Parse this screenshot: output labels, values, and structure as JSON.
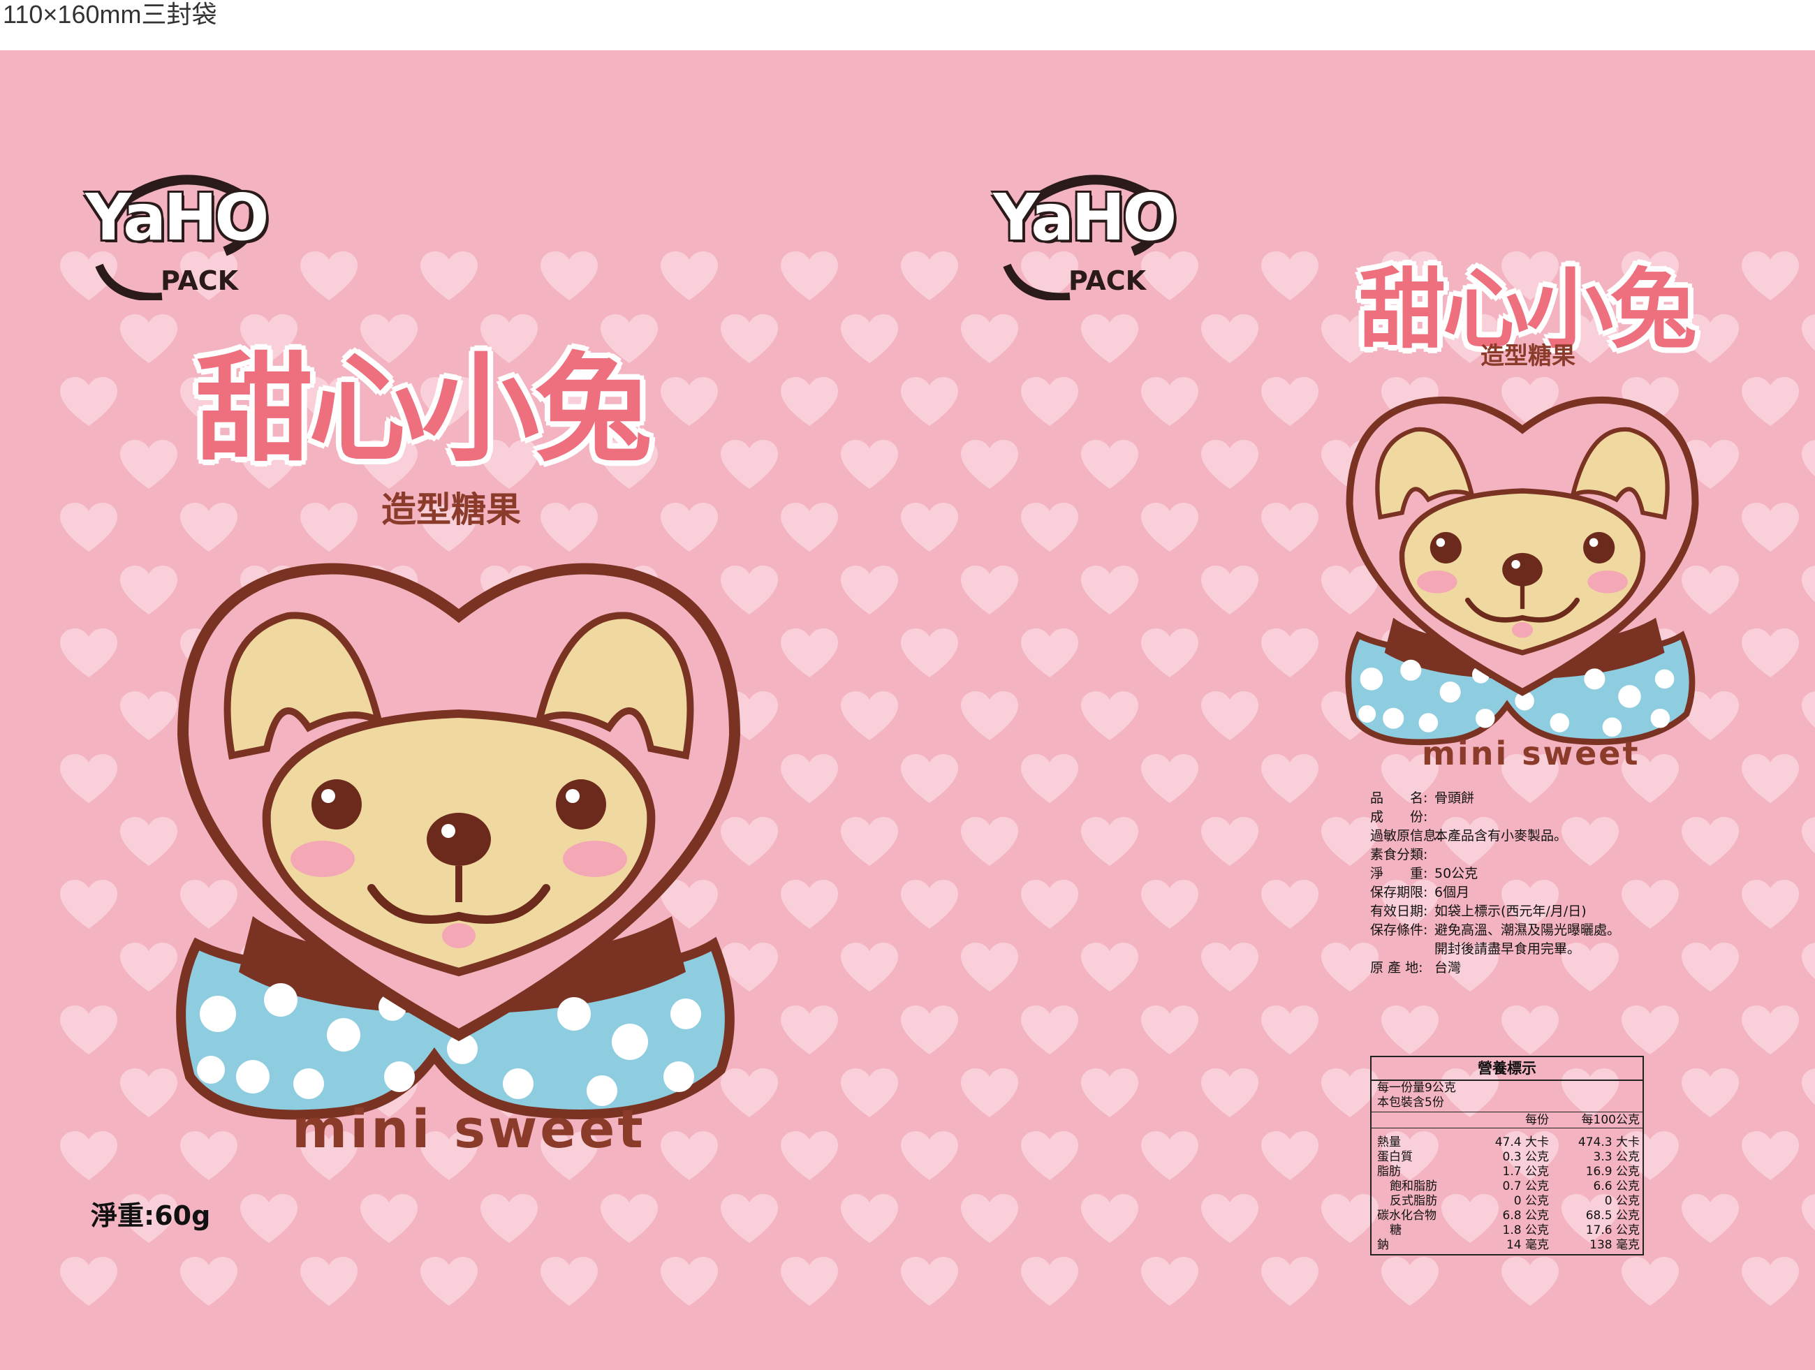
{
  "caption": "110×160mm三封袋",
  "brand": {
    "name": "YaHO",
    "sub": "PACK"
  },
  "product": {
    "title": "甜心小兔",
    "subtitle": "造型糖果",
    "tagline": "mini sweet"
  },
  "front": {
    "net_weight": "淨重:60g"
  },
  "info": {
    "rows": [
      {
        "label": "品　　名:",
        "value": "骨頭餅"
      },
      {
        "label": "成　　份:",
        "value": ""
      },
      {
        "label": "過敏原信息:",
        "value": "本產品含有小麥製品。"
      },
      {
        "label": "素食分類:",
        "value": ""
      },
      {
        "label": "淨　　重:",
        "value": "50公克"
      },
      {
        "label": "保存期限:",
        "value": "6個月"
      },
      {
        "label": "有效日期:",
        "value": "如袋上標示(西元年/月/日)"
      },
      {
        "label": "保存條件:",
        "value": "避免高溫、潮濕及陽光曝曬處。"
      },
      {
        "label": "",
        "value": "開封後請盡早食用完畢。"
      },
      {
        "label": "原 產 地:",
        "value": "台灣"
      }
    ]
  },
  "nutrition": {
    "title": "營養標示",
    "serving": "每一份量9公克",
    "servings": "本包裝含5份",
    "col_per_serving": "每份",
    "col_per_100": "每100公克",
    "rows": [
      {
        "name": "熱量",
        "per": "47.4 大卡",
        "per100": "474.3 大卡",
        "indent": false
      },
      {
        "name": "蛋白質",
        "per": "0.3 公克",
        "per100": "3.3 公克",
        "indent": false
      },
      {
        "name": "脂肪",
        "per": "1.7 公克",
        "per100": "16.9 公克",
        "indent": false
      },
      {
        "name": "飽和脂肪",
        "per": "0.7 公克",
        "per100": "6.6 公克",
        "indent": true
      },
      {
        "name": "反式脂肪",
        "per": "0 公克",
        "per100": "0 公克",
        "indent": true
      },
      {
        "name": "碳水化合物",
        "per": "6.8 公克",
        "per100": "68.5 公克",
        "indent": false
      },
      {
        "name": "糖",
        "per": "1.8 公克",
        "per100": "17.6 公克",
        "indent": true
      },
      {
        "name": "鈉",
        "per": "14 毫克",
        "per100": "138 毫克",
        "indent": false
      }
    ]
  },
  "colors": {
    "background": "#f4b3c1",
    "heart": "#f9d0da",
    "title_pink": "#ee6f7d",
    "brown": "#8a3b2a",
    "face": "#f0d9a0",
    "scarf_blue": "#8ecde0"
  }
}
